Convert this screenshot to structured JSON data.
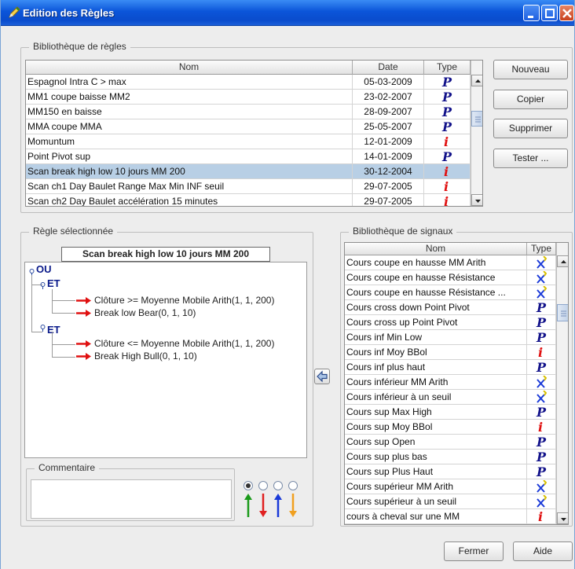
{
  "window": {
    "title": "Edition des Règles"
  },
  "rules_library": {
    "title": "Bibliothèque de règles",
    "columns": {
      "name": "Nom",
      "date": "Date",
      "type": "Type"
    },
    "rows": [
      {
        "name": "Espagnol Intra C > max",
        "date": "05-03-2009",
        "type": "P"
      },
      {
        "name": "MM1 coupe baisse MM2",
        "date": "23-02-2007",
        "type": "P"
      },
      {
        "name": "MM150 en baisse",
        "date": "28-09-2007",
        "type": "P"
      },
      {
        "name": "MMA coupe MMA",
        "date": "25-05-2007",
        "type": "P"
      },
      {
        "name": "Momuntum",
        "date": "12-01-2009",
        "type": "i"
      },
      {
        "name": "Point Pivot sup",
        "date": "14-01-2009",
        "type": "P"
      },
      {
        "name": "Scan break high low 10 jours MM 200",
        "date": "30-12-2004",
        "type": "i",
        "selected": true
      },
      {
        "name": "Scan ch1 Day Baulet Range Max Min INF seuil",
        "date": "29-07-2005",
        "type": "i"
      },
      {
        "name": "Scan ch2 Day Baulet accélération 15 minutes",
        "date": "29-07-2005",
        "type": "i"
      }
    ],
    "buttons": {
      "new": "Nouveau",
      "copy": "Copier",
      "delete": "Supprimer",
      "test": "Tester ..."
    }
  },
  "selected_rule": {
    "title": "Règle sélectionnée",
    "rule_name": "Scan break high low 10 jours MM 200",
    "tree": {
      "root": "OU",
      "branch1": {
        "label": "ET",
        "cond1": "Clôture >= Moyenne Mobile Arith(1, 1, 200)",
        "cond2": "Break low Bear(0, 1, 10)"
      },
      "branch2": {
        "label": "ET",
        "cond1": "Clôture <= Moyenne Mobile Arith(1, 1, 200)",
        "cond2": "Break High Bull(0, 1, 10)"
      }
    },
    "comment_title": "Commentaire",
    "comment": "",
    "arrow_colors": [
      "#1a9a1a",
      "#e02020",
      "#1a3ad8",
      "#f0a020"
    ]
  },
  "signals_library": {
    "title": "Bibliothèque de signaux",
    "columns": {
      "name": "Nom",
      "type": "Type"
    },
    "rows": [
      {
        "name": "Cours coupe en hausse MM Arith",
        "type": "X"
      },
      {
        "name": "Cours coupe en hausse Résistance",
        "type": "X"
      },
      {
        "name": "Cours coupe en hausse Résistance ...",
        "type": "X"
      },
      {
        "name": "Cours cross down Point Pivot",
        "type": "P"
      },
      {
        "name": "Cours cross up Point Pivot",
        "type": "P"
      },
      {
        "name": "Cours inf Min Low",
        "type": "P"
      },
      {
        "name": "Cours inf Moy BBol",
        "type": "i"
      },
      {
        "name": "Cours inf plus haut",
        "type": "P"
      },
      {
        "name": "Cours inférieur MM Arith",
        "type": "X"
      },
      {
        "name": "Cours inférieur à un seuil",
        "type": "X"
      },
      {
        "name": "Cours sup Max High",
        "type": "P"
      },
      {
        "name": "Cours sup Moy BBol",
        "type": "i"
      },
      {
        "name": "Cours sup Open",
        "type": "P"
      },
      {
        "name": "Cours sup plus bas",
        "type": "P"
      },
      {
        "name": "Cours sup Plus Haut",
        "type": "P"
      },
      {
        "name": "Cours supérieur MM Arith",
        "type": "X"
      },
      {
        "name": "Cours supérieur à un seuil",
        "type": "X"
      },
      {
        "name": "cours à cheval sur une MM",
        "type": "i"
      }
    ]
  },
  "footer": {
    "close": "Fermer",
    "help": "Aide"
  }
}
